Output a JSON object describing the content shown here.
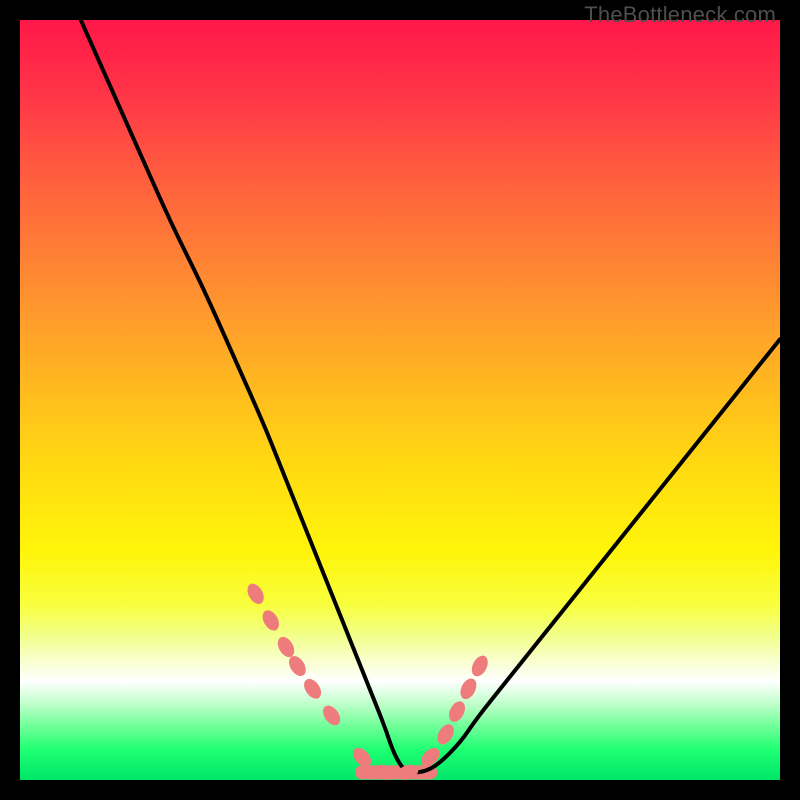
{
  "watermark": "TheBottleneck.com",
  "chart_data": {
    "type": "line",
    "title": "",
    "xlabel": "",
    "ylabel": "",
    "xlim": [
      0,
      100
    ],
    "ylim": [
      0,
      100
    ],
    "series": [
      {
        "name": "bottleneck-curve",
        "x": [
          8,
          12,
          16,
          20,
          24,
          28,
          32,
          34,
          36,
          38,
          40,
          42,
          44,
          46,
          48,
          49,
          50,
          51,
          53,
          55,
          58,
          60,
          64,
          68,
          72,
          76,
          80,
          84,
          88,
          92,
          96,
          100
        ],
        "y": [
          100,
          91,
          82,
          73,
          65,
          56,
          47,
          42,
          37,
          32,
          27,
          22,
          17,
          12,
          7,
          4,
          2,
          1,
          1,
          2,
          5,
          8,
          13,
          18,
          23,
          28,
          33,
          38,
          43,
          48,
          53,
          58
        ]
      }
    ],
    "markers": {
      "name": "highlight-points",
      "x": [
        31,
        33,
        35,
        36.5,
        38.5,
        41,
        45,
        48,
        51,
        54,
        56,
        57.5,
        59,
        60.5
      ],
      "y": [
        24.5,
        21,
        17.5,
        15,
        12,
        8.5,
        3,
        1,
        1,
        3,
        6,
        9,
        12,
        15
      ]
    },
    "flat_segment": {
      "x": [
        45,
        54
      ],
      "y": [
        1,
        1
      ]
    },
    "colors": {
      "curve": "#000000",
      "markers": "#ef7c7c",
      "gradient_top": "#ff1749",
      "gradient_bottom": "#00e668"
    }
  }
}
